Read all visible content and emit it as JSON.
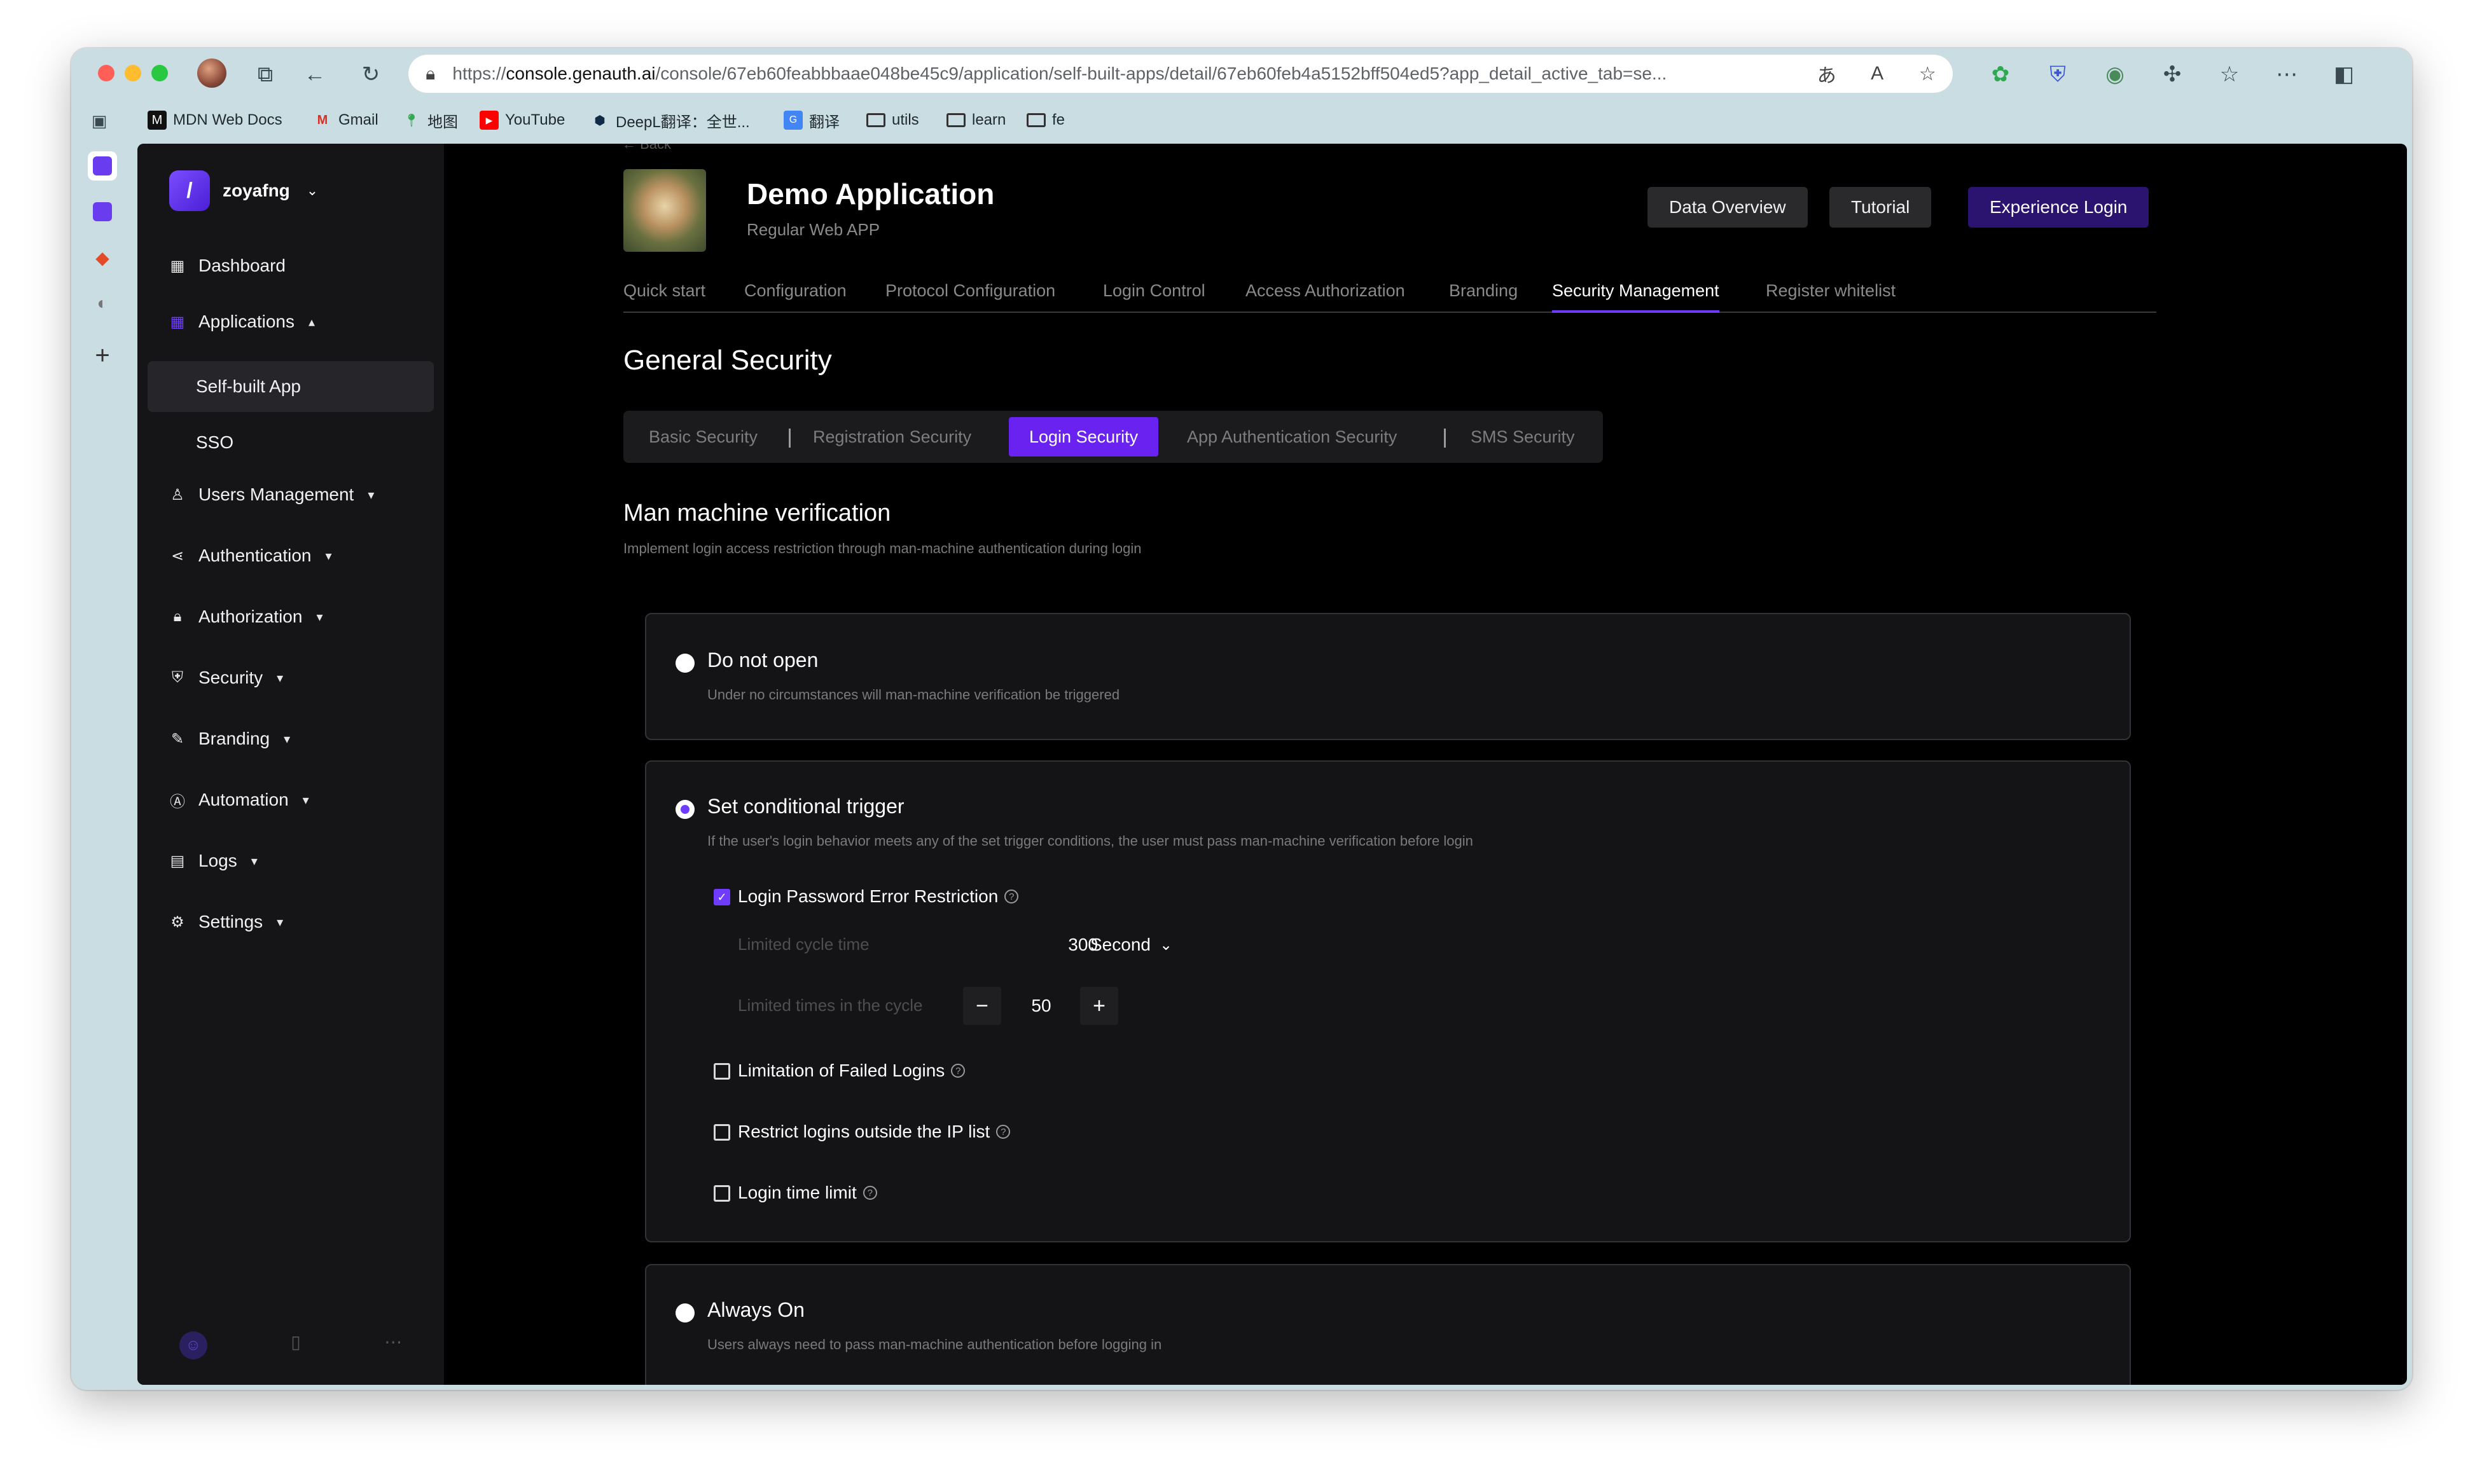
{
  "browser": {
    "url_prefix": "https://",
    "url_host": "console.genauth.ai",
    "url_path": "/console/67eb60feabbbaae048be45c9/application/self-built-apps/detail/67eb60feb4a5152bff504ed5?app_detail_active_tab=se...",
    "bookmarks": [
      {
        "label": "MDN Web Docs",
        "icon": "mdn-icon"
      },
      {
        "label": "Gmail",
        "icon": "gmail-icon"
      },
      {
        "label": "地图",
        "icon": "maps-icon"
      },
      {
        "label": "YouTube",
        "icon": "youtube-icon"
      },
      {
        "label": "DeepL翻译：全世...",
        "icon": "deepl-icon"
      },
      {
        "label": "翻译",
        "icon": "translate-icon"
      },
      {
        "label": "utils",
        "icon": "folder-icon"
      },
      {
        "label": "learn",
        "icon": "folder-icon"
      },
      {
        "label": "fe",
        "icon": "folder-icon"
      }
    ]
  },
  "sidebar": {
    "org_name": "zoyafng",
    "items": [
      {
        "label": "Dashboard",
        "icon": "dashboard-icon"
      },
      {
        "label": "Applications",
        "icon": "applications-icon"
      },
      {
        "label": "Users Management",
        "icon": "users-icon"
      },
      {
        "label": "Authentication",
        "icon": "authentication-icon"
      },
      {
        "label": "Authorization",
        "icon": "lock-icon"
      },
      {
        "label": "Security",
        "icon": "shield-icon"
      },
      {
        "label": "Branding",
        "icon": "brush-icon"
      },
      {
        "label": "Automation",
        "icon": "automation-icon"
      },
      {
        "label": "Logs",
        "icon": "logs-icon"
      },
      {
        "label": "Settings",
        "icon": "gear-icon"
      }
    ],
    "sub_items": [
      "Self-built App",
      "SSO"
    ]
  },
  "header": {
    "back": "← Back",
    "app_name": "Demo Application",
    "app_type": "Regular Web APP",
    "buttons": [
      "Data Overview",
      "Tutorial",
      "Experience Login"
    ]
  },
  "tabs": [
    "Quick start",
    "Configuration",
    "Protocol Configuration",
    "Login Control",
    "Access Authorization",
    "Branding",
    "Security Management",
    "Register whitelist"
  ],
  "section_title": "General Security",
  "segments": [
    "Basic Security",
    "Registration Security",
    "Login Security",
    "App Authentication Security",
    "SMS Security"
  ],
  "mm": {
    "title": "Man machine verification",
    "desc": "Implement login access restriction through man-machine authentication during login",
    "options": [
      {
        "title": "Do not open",
        "desc": "Under no circumstances will man-machine verification be triggered",
        "selected": false
      },
      {
        "title": "Set conditional trigger",
        "desc": "If the user's login behavior meets any of the set trigger conditions, the user must pass man-machine verification before login",
        "selected": true
      },
      {
        "title": "Always On",
        "desc": "Users always need to pass man-machine authentication before logging in",
        "selected": false
      }
    ],
    "conditions": [
      {
        "label": "Login Password Error Restriction",
        "checked": true
      },
      {
        "label": "Limitation of Failed Logins",
        "checked": false
      },
      {
        "label": "Restrict logins outside the IP list",
        "checked": false
      },
      {
        "label": "Login time limit",
        "checked": false
      }
    ],
    "limited_cycle_label": "Limited cycle time",
    "limited_cycle_value": "300",
    "limited_cycle_unit": "Second",
    "limited_times_label": "Limited times in the cycle",
    "limited_times_value": "50"
  },
  "colors": {
    "accent": "#6f3cff",
    "background": "#000000",
    "sidebar": "#151517"
  }
}
